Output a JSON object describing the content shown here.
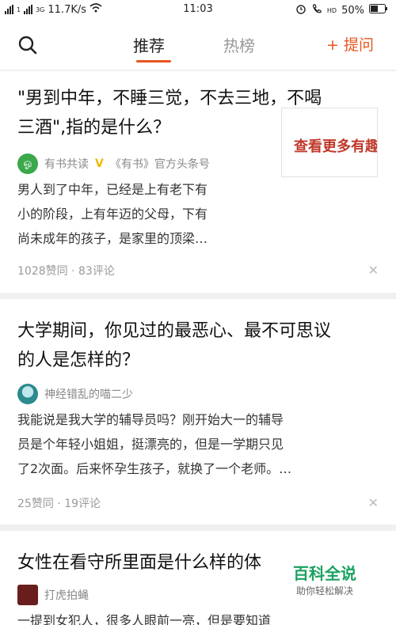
{
  "statusbar": {
    "signal1": "1",
    "signal2": "3G",
    "speed": "11.7K/s",
    "time": "11:03",
    "hd": "HD",
    "battery": "50%"
  },
  "nav": {
    "tab_recommend": "推荐",
    "tab_hot": "热榜",
    "ask_label": "+ 提问"
  },
  "feed": [
    {
      "title": "\"男到中年，不睡三觉，不去三地，不喝三酒\",指的是什么？",
      "title_line1": "\"男到中年，不睡三觉，不去三地，不喝",
      "title_line2": "三酒\",指的是什么？",
      "avatar_text": "ஓ",
      "author": "有书共读",
      "author_verified": "V",
      "author_desc": "《有书》官方头条号",
      "excerpt_line1": "男人到了中年，已经是上有老下有",
      "excerpt_line2": "小的阶段，上有年迈的父母，下有",
      "excerpt_line3": "尚未成年的孩子，是家里的顶梁…",
      "thumb_text": "查看更多有趣",
      "likes": "1028赞同",
      "dot": "·",
      "comments": "83评论",
      "close": "✕"
    },
    {
      "title_line1": "大学期间，你见过的最恶心、最不可思议",
      "title_line2": "的人是怎样的？",
      "author": "神经错乱的喵二少",
      "excerpt_line1": "我能说是我大学的辅导员吗？刚开始大一的辅导",
      "excerpt_line2": "员是个年轻小姐姐，挺漂亮的，但是一学期只见",
      "excerpt_line3": "了2次面。后来怀孕生孩子，就换了一个老师。…",
      "likes": "25赞同",
      "dot": "·",
      "comments": "19评论",
      "close": "✕"
    },
    {
      "title_line1": "女性在看守所里面是什么样的体",
      "author": "打虎拍蝇",
      "excerpt_line1": "一提到女犯人，很多人眼前一亮，但是要知道"
    }
  ],
  "watermark": {
    "title": "百科全说",
    "subtitle": "助你轻松解决"
  }
}
